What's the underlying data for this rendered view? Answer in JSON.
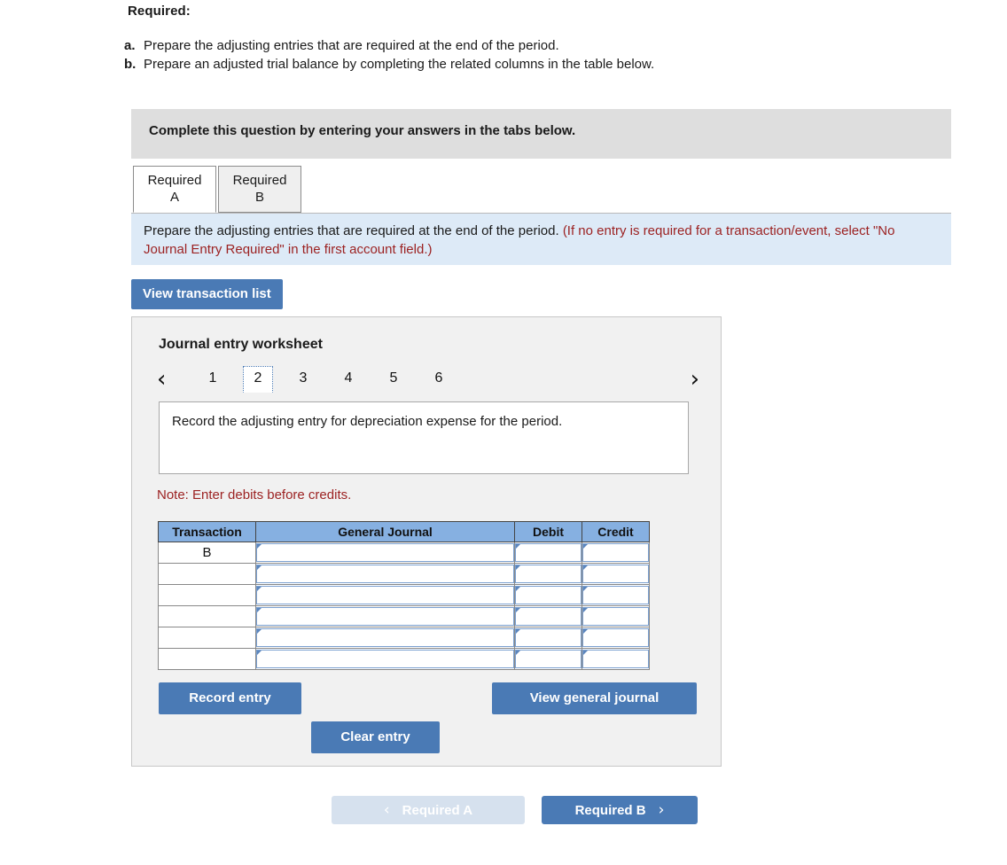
{
  "required": {
    "heading": "Required:",
    "items": [
      {
        "marker": "a.",
        "text": "Prepare the adjusting entries that are required at the end of the period."
      },
      {
        "marker": "b.",
        "text": "Prepare an adjusted trial balance by completing the related columns in the table below."
      }
    ]
  },
  "banner": {
    "text": "Complete this question by entering your answers in the tabs below."
  },
  "tabs": [
    {
      "line1": "Required",
      "line2": "A",
      "active": true
    },
    {
      "line1": "Required",
      "line2": "B",
      "active": false
    }
  ],
  "instruction": {
    "black_text": "Prepare the adjusting entries that are required at the end of the period. ",
    "red_text": "(If no entry is required for a transaction/event, select \"No Journal Entry Required\" in the first account field.)"
  },
  "toolbar": {
    "view_transaction_list_label": "View transaction list"
  },
  "worksheet": {
    "title": "Journal entry worksheet",
    "pager": {
      "prev_icon": "chevron-left",
      "next_icon": "chevron-right",
      "prev_glyph": "‹",
      "next_glyph": "›",
      "pages": [
        "1",
        "2",
        "3",
        "4",
        "5",
        "6"
      ],
      "active_page": "2"
    },
    "prompt": "Record the adjusting entry for depreciation expense for the period.",
    "note": "Note: Enter debits before credits.",
    "table": {
      "headers": [
        "Transaction",
        "General Journal",
        "Debit",
        "Credit"
      ],
      "rows": [
        {
          "transaction": "B",
          "general_journal": "",
          "debit": "",
          "credit": ""
        },
        {
          "transaction": "",
          "general_journal": "",
          "debit": "",
          "credit": ""
        },
        {
          "transaction": "",
          "general_journal": "",
          "debit": "",
          "credit": ""
        },
        {
          "transaction": "",
          "general_journal": "",
          "debit": "",
          "credit": ""
        },
        {
          "transaction": "",
          "general_journal": "",
          "debit": "",
          "credit": ""
        },
        {
          "transaction": "",
          "general_journal": "",
          "debit": "",
          "credit": ""
        }
      ]
    },
    "buttons": {
      "record_entry": "Record entry",
      "clear_entry": "Clear entry",
      "view_general_journal": "View general journal"
    }
  },
  "bottom_nav": {
    "prev_label": "Required A",
    "next_label": "Required B",
    "prev_glyph": "‹",
    "next_glyph": "›",
    "prev_disabled": true
  },
  "colors": {
    "accent_blue": "#4a7ab5",
    "table_header_blue": "#86b0e1",
    "instruction_panel_blue": "#ddeaf7",
    "banner_gray": "#dedede",
    "panel_gray": "#f1f1f1",
    "red_text": "#9c2222",
    "disabled_blue": "#d6e1ee"
  }
}
